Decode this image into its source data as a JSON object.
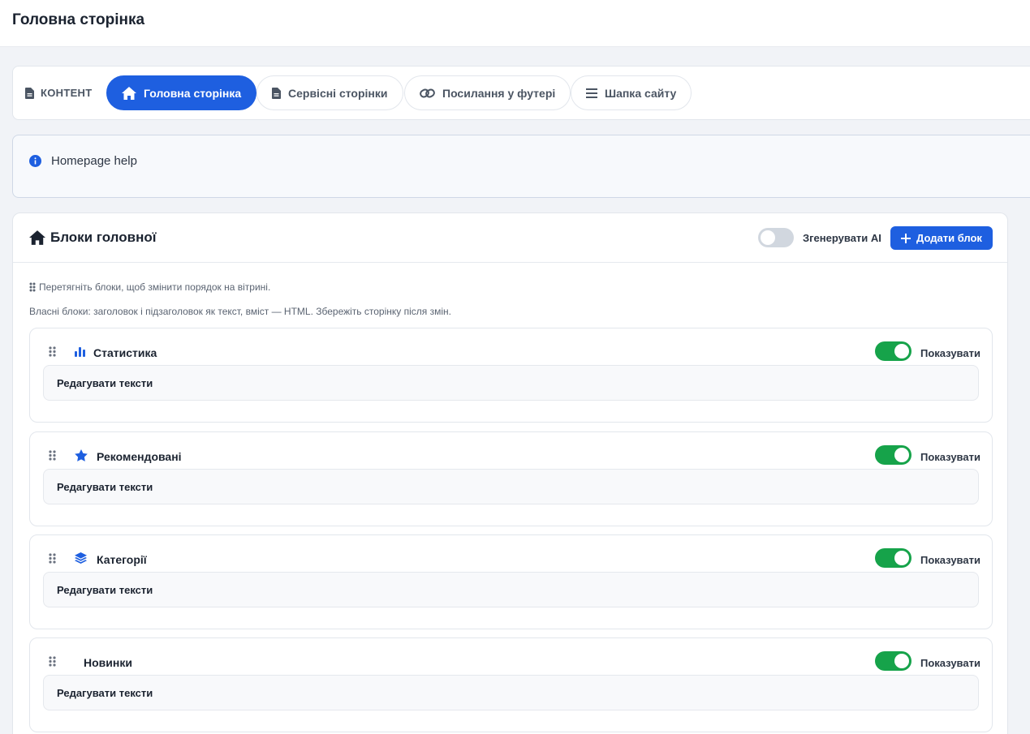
{
  "page": {
    "title": "Головна сторінка"
  },
  "tabs_bar": {
    "section_label": "КОНТЕНТ",
    "tabs": [
      {
        "label": "Головна сторінка",
        "icon": "home-icon",
        "active": true
      },
      {
        "label": "Сервісні сторінки",
        "icon": "file-icon",
        "active": false
      },
      {
        "label": "Посилання у футері",
        "icon": "link-icon",
        "active": false
      },
      {
        "label": "Шапка сайту",
        "icon": "menu-icon",
        "active": false
      }
    ]
  },
  "help": {
    "text": "Homepage help",
    "icon": "info-icon"
  },
  "blocks": {
    "title": "Блоки головної",
    "ai_toggle_label": "Згенерувати AI",
    "ai_toggle_on": false,
    "add_button_label": "Додати блок",
    "hint_drag": "Перетягніть блоки, щоб змінити порядок на вітрині.",
    "hint_custom": "Власні блоки: заголовок і підзаголовок як текст, вміст — HTML. Збережіть сторінку після змін.",
    "items": [
      {
        "name": "Статистика",
        "icon": "bar-chart-icon",
        "show_label": "Показувати",
        "visible": true,
        "edit_label": "Редагувати тексти"
      },
      {
        "name": "Рекомендовані",
        "icon": "star-icon",
        "show_label": "Показувати",
        "visible": true,
        "edit_label": "Редагувати тексти"
      },
      {
        "name": "Категорії",
        "icon": "layers-icon",
        "show_label": "Показувати",
        "visible": true,
        "edit_label": "Редагувати тексти"
      },
      {
        "name": "Новинки",
        "icon": "",
        "show_label": "Показувати",
        "visible": true,
        "edit_label": "Редагувати тексти"
      }
    ]
  },
  "colors": {
    "accent": "#1e5fe0",
    "success": "#16a34a",
    "toggle_off": "#d1d7df"
  }
}
